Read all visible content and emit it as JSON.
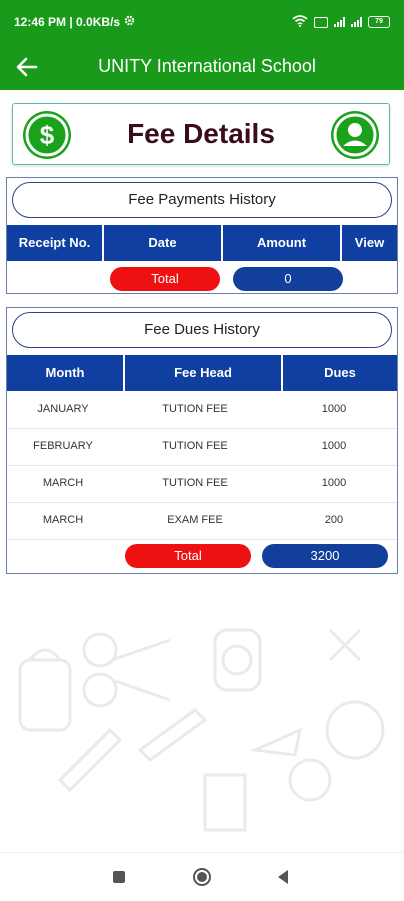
{
  "status": {
    "time_label": "12:46 PM | 0.0KB/s",
    "battery": "79"
  },
  "appbar": {
    "title": "UNITY International School"
  },
  "header": {
    "title": "Fee Details"
  },
  "payments": {
    "title": "Fee Payments History",
    "columns": [
      "Receipt No.",
      "Date",
      "Amount",
      "View"
    ],
    "total_label": "Total",
    "total_value": "0"
  },
  "dues": {
    "title": "Fee Dues History",
    "columns": [
      "Month",
      "Fee Head",
      "Dues"
    ],
    "rows": [
      {
        "month": "JANUARY",
        "head": "TUTION FEE",
        "dues": "1000"
      },
      {
        "month": "FEBRUARY",
        "head": "TUTION FEE",
        "dues": "1000"
      },
      {
        "month": "MARCH",
        "head": "TUTION FEE",
        "dues": "1000"
      },
      {
        "month": "MARCH",
        "head": "EXAM FEE",
        "dues": "200"
      }
    ],
    "total_label": "Total",
    "total_value": "3200"
  },
  "colors": {
    "brand_green": "#1a9a1a",
    "table_header_blue": "#0f3fa0",
    "total_red": "#ee1111",
    "total_blue": "#123e9c"
  }
}
